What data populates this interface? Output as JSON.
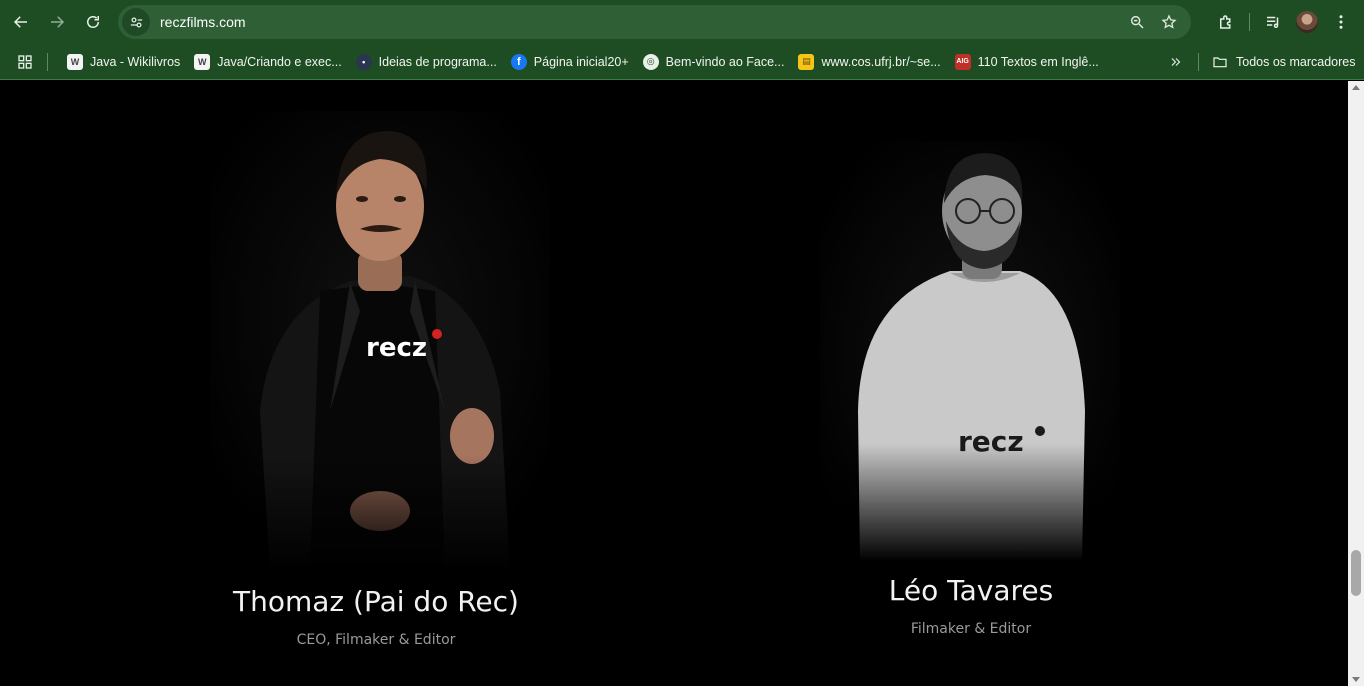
{
  "browser": {
    "url": "reczfilms.com",
    "bookmarks": [
      {
        "label": "Java - Wikilivros",
        "icon": "wikibooks-icon"
      },
      {
        "label": "Java/Criando e exec...",
        "icon": "wikibooks-icon"
      },
      {
        "label": "Ideias de programa...",
        "icon": "site-icon"
      },
      {
        "label": "Página inicial20+",
        "icon": "facebook-icon"
      },
      {
        "label": "Bem-vindo ao Face...",
        "icon": "globe-icon"
      },
      {
        "label": "www.cos.ufrj.br/~se...",
        "icon": "document-icon"
      },
      {
        "label": "110 Textos em Inglê...",
        "icon": "aig-icon"
      }
    ],
    "bookmarks_folder": "Todos os marcadores",
    "theme_color": "#1e4d24"
  },
  "team": [
    {
      "name": "Thomaz (Pai do Rec)",
      "role": "CEO, Filmaker & Editor",
      "shirt_logo": "recz"
    },
    {
      "name": "Léo Tavares",
      "role": "Filmaker & Editor",
      "shirt_logo": "recz"
    }
  ]
}
